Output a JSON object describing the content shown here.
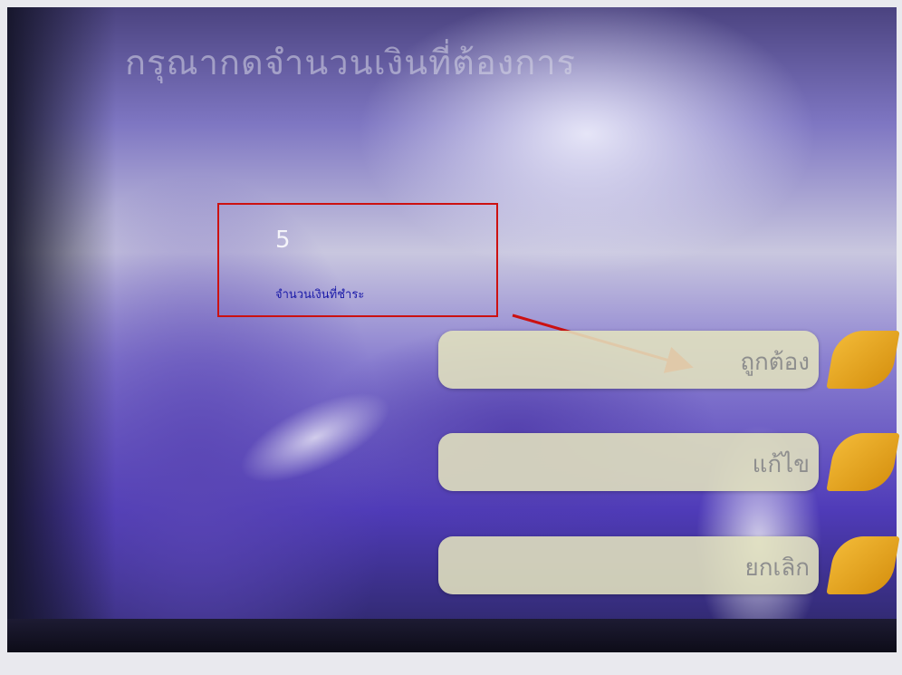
{
  "screen": {
    "heading": "กรุณากดจำนวนเงินที่ต้องการ"
  },
  "amount_panel": {
    "value": "5",
    "label": "จำนวนเงินที่ชำระ"
  },
  "menu": {
    "confirm_label": "ถูกต้อง",
    "edit_label": "แก้ไข",
    "cancel_label": "ยกเลิก"
  },
  "colors": {
    "highlight_box": "#cc1111",
    "arrow": "#cc1111",
    "side_key": "#e7a21c",
    "button_face": "#e2e2be"
  }
}
